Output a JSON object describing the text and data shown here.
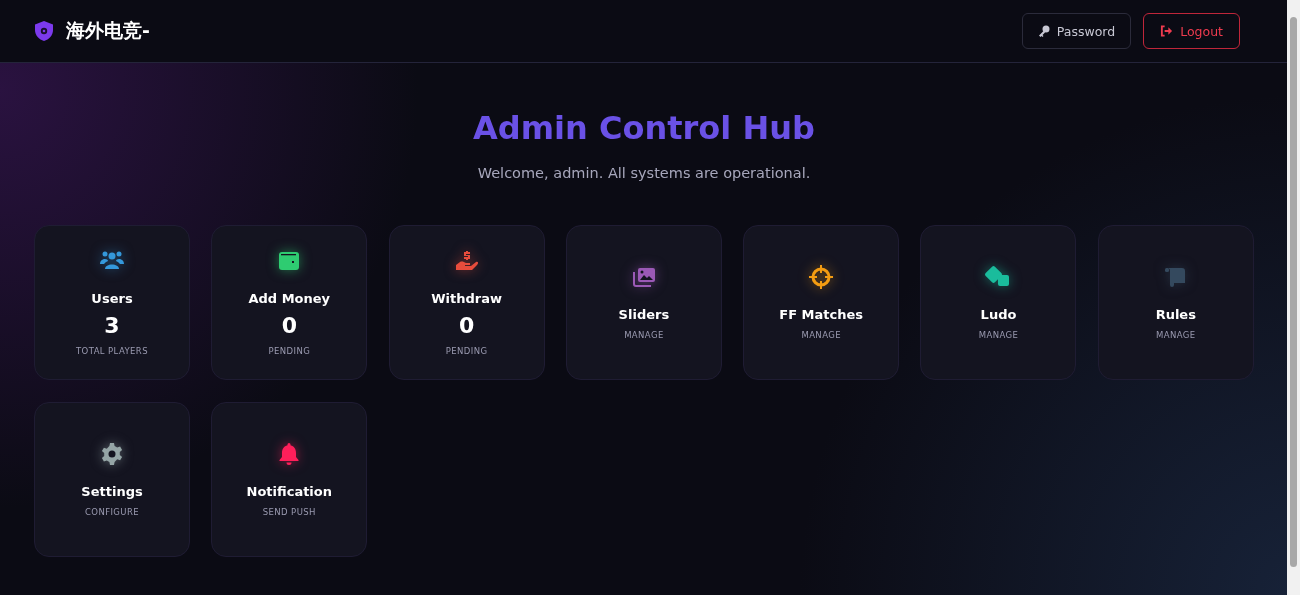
{
  "brand": {
    "title": "海外电竞-"
  },
  "header_buttons": [
    {
      "label": "Password",
      "kind": "neutral"
    },
    {
      "label": "Logout",
      "kind": "danger"
    }
  ],
  "hero": {
    "title": "Admin Control Hub",
    "subtitle": "Welcome, admin. All systems are operational."
  },
  "cards": [
    {
      "kind": "stat",
      "title": "Users",
      "value": "3",
      "caption": "TOTAL PLAYERS",
      "color": "#3498db"
    },
    {
      "kind": "stat",
      "title": "Add Money",
      "value": "0",
      "caption": "PENDING",
      "color": "#2ecc71"
    },
    {
      "kind": "stat",
      "title": "Withdraw",
      "value": "0",
      "caption": "PENDING",
      "color": "#e74c3c"
    },
    {
      "kind": "link",
      "title": "Sliders",
      "caption": "MANAGE",
      "color": "#9b59b6"
    },
    {
      "kind": "link",
      "title": "FF Matches",
      "caption": "MANAGE",
      "color": "#f39c12"
    },
    {
      "kind": "link",
      "title": "Ludo",
      "caption": "MANAGE",
      "color": "#1abc9c"
    },
    {
      "kind": "link",
      "title": "Rules",
      "caption": "MANAGE",
      "color": "#34495e"
    },
    {
      "kind": "link",
      "title": "Settings",
      "caption": "CONFIGURE",
      "color": "#95a5a6"
    },
    {
      "kind": "link",
      "title": "Notification",
      "caption": "SEND PUSH",
      "color": "#ff1f5a"
    }
  ]
}
